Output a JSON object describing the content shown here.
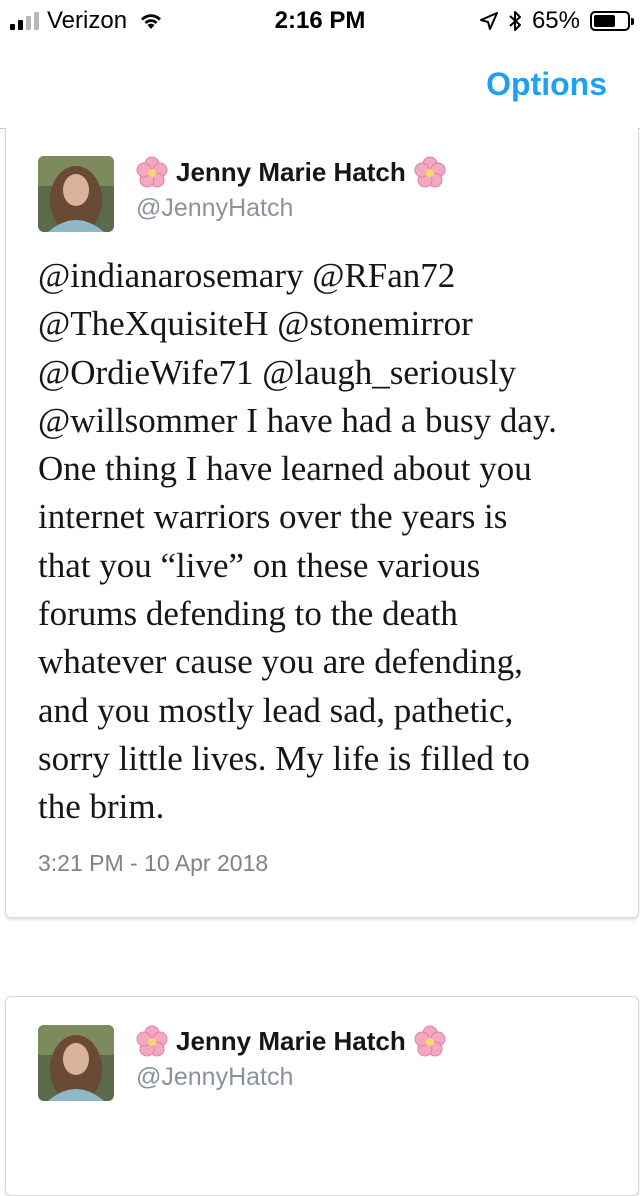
{
  "status_bar": {
    "carrier": "Verizon",
    "time": "2:16 PM",
    "battery_percent": "65%",
    "battery_level": 0.65,
    "signal_bars_filled": 2,
    "signal_bars_total": 4
  },
  "nav": {
    "options_label": "Options",
    "accent_color": "#1da1f2"
  },
  "tweets": [
    {
      "display_name": "Jenny Marie Hatch",
      "handle": "@JennyHatch",
      "text_lines": [
        "@indianarosemary @RFan72",
        "@TheXquisiteH @stonemirror",
        "@OrdieWife71 @laugh_seriously",
        "@willsommer I have had a busy day.",
        "One thing I have learned about you",
        "internet warriors over the years is",
        "that you “live” on these various",
        "forums defending to the death",
        "whatever cause you are defending,",
        "and you mostly lead sad, pathetic,",
        "sorry little lives. My life is filled to",
        "the brim."
      ],
      "timestamp": "3:21 PM - 10 Apr 2018"
    },
    {
      "display_name": "Jenny Marie Hatch",
      "handle": "@JennyHatch"
    }
  ],
  "icons": {
    "name_decoration": "cherry-blossom-icon"
  }
}
